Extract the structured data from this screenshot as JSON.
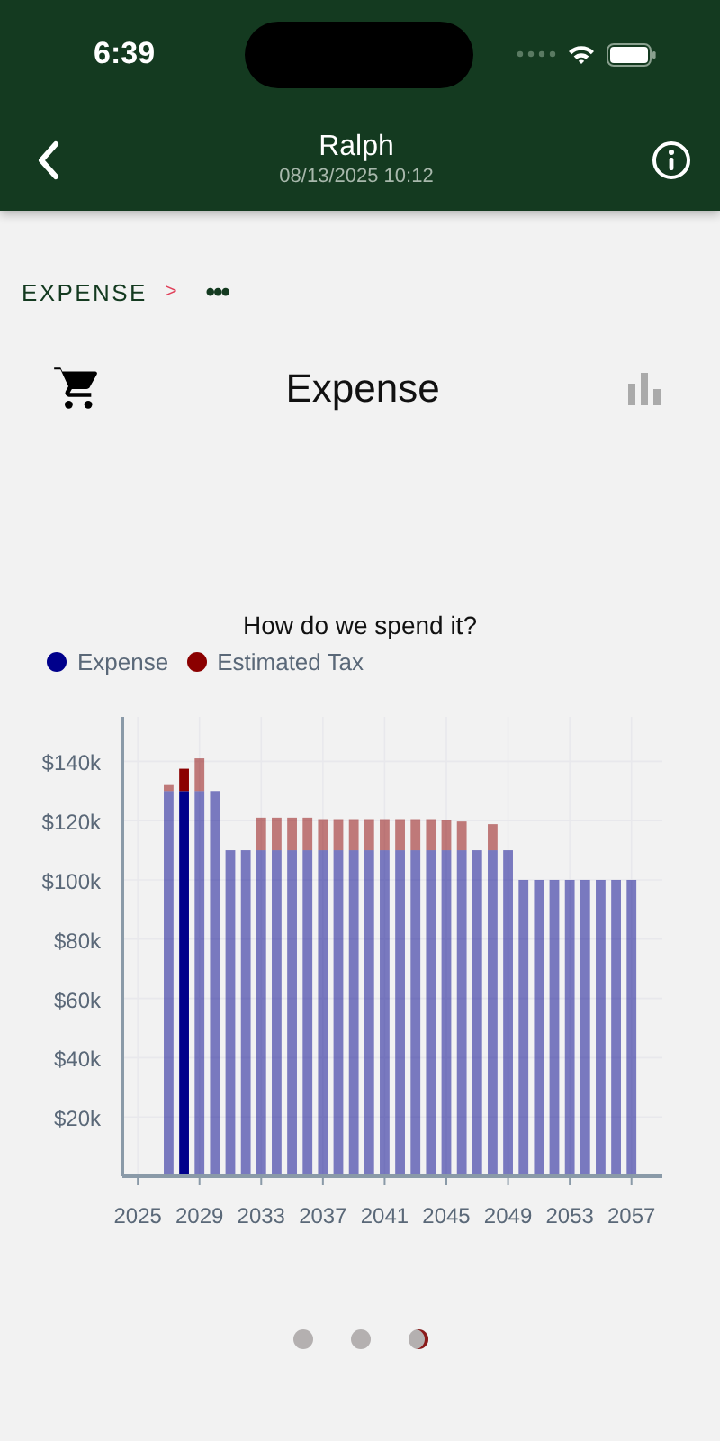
{
  "status_bar": {
    "time": "6:39"
  },
  "nav": {
    "title": "Ralph",
    "subtitle": "08/13/2025 10:12"
  },
  "breadcrumb": {
    "label": "EXPENSE",
    "separator": ">",
    "more": "•••"
  },
  "header": {
    "title": "Expense"
  },
  "chart": {
    "chart_data": {
      "type": "bar",
      "title": "How do we spend it?",
      "stacked": true,
      "grid": true,
      "x": [
        2027,
        2028,
        2029,
        2030,
        2031,
        2032,
        2033,
        2034,
        2035,
        2036,
        2037,
        2038,
        2039,
        2040,
        2041,
        2042,
        2043,
        2044,
        2045,
        2046,
        2047,
        2048,
        2049,
        2050,
        2051,
        2052,
        2053,
        2054,
        2055,
        2056,
        2057
      ],
      "series": [
        {
          "name": "Expense",
          "color": "#00008b",
          "values": [
            130,
            130,
            130,
            130,
            110,
            110,
            110,
            110,
            110,
            110,
            110,
            110,
            110,
            110,
            110,
            110,
            110,
            110,
            110,
            110,
            110,
            110,
            110,
            100,
            100,
            100,
            100,
            100,
            100,
            100,
            100
          ]
        },
        {
          "name": "Estimated Tax",
          "color": "#8b0000",
          "values": [
            2,
            7.5,
            11,
            null,
            null,
            null,
            11,
            11,
            11,
            11,
            10.5,
            10.5,
            10.5,
            10.5,
            10.5,
            10.5,
            10.5,
            10.5,
            10.3,
            9.7,
            null,
            8.8,
            null,
            null,
            null,
            null,
            null,
            null,
            null,
            null,
            null
          ]
        }
      ],
      "ylim": [
        0,
        155
      ],
      "xlim": [
        2024,
        2059
      ],
      "yticks": [
        {
          "value": 20,
          "label": "$20k"
        },
        {
          "value": 40,
          "label": "$40k"
        },
        {
          "value": 60,
          "label": "$60k"
        },
        {
          "value": 80,
          "label": "$80k"
        },
        {
          "value": 100,
          "label": "$100k"
        },
        {
          "value": 120,
          "label": "$120k"
        },
        {
          "value": 140,
          "label": "$140k"
        }
      ],
      "xticks": [
        2025,
        2029,
        2033,
        2037,
        2041,
        2045,
        2049,
        2053,
        2057
      ]
    }
  },
  "bars": [
    {
      "selected": false
    },
    {
      "selected": true
    },
    {
      "selected": false
    },
    {
      "selected": false
    },
    {
      "selected": false
    },
    {
      "selected": false
    },
    {
      "selected": false
    },
    {
      "selected": false
    },
    {
      "selected": false
    },
    {
      "selected": false
    },
    {
      "selected": false
    },
    {
      "selected": false
    },
    {
      "selected": false
    },
    {
      "selected": false
    },
    {
      "selected": false
    },
    {
      "selected": false
    },
    {
      "selected": false
    },
    {
      "selected": false
    },
    {
      "selected": false
    },
    {
      "selected": false
    },
    {
      "selected": false
    },
    {
      "selected": false
    },
    {
      "selected": false
    },
    {
      "selected": false
    },
    {
      "selected": false
    },
    {
      "selected": false
    },
    {
      "selected": false
    },
    {
      "selected": false
    },
    {
      "selected": false
    },
    {
      "selected": false
    },
    {
      "selected": false
    }
  ],
  "pages": [
    {
      "selected": false
    },
    {
      "selected": false
    },
    {
      "selected": true
    }
  ]
}
